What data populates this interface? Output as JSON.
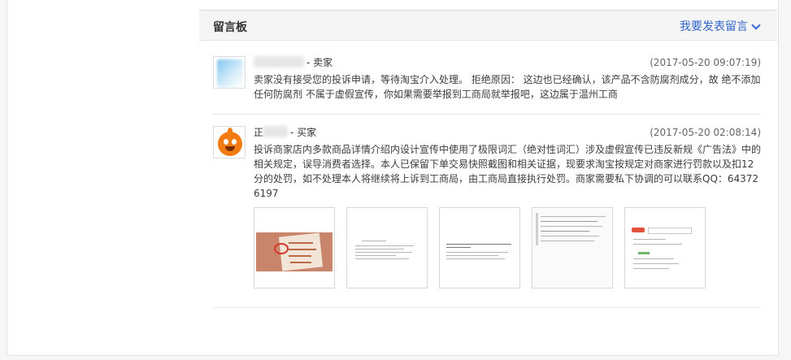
{
  "board": {
    "title": "留言板",
    "post_link": "我要发表留言"
  },
  "messages": [
    {
      "name_prefix": "",
      "role": "- 卖家",
      "timestamp": "(2017-05-20 09:07:19)",
      "content": "卖家没有接受您的投诉申请，等待淘宝介入处理。 拒绝原因： 这边也已经确认，该产品不含防腐剂成分，故 绝不添加任何防腐剂 不属于虚假宣传，你如果需要举报到工商局就举报吧，这边属于温州工商"
    },
    {
      "name_prefix": "正",
      "role": "- 买家",
      "timestamp": "(2017-05-20 02:08:14)",
      "content": "投诉商家店内多款商品详情介绍内设计宣传中使用了极限词汇（绝对性词汇）涉及虚假宣传已违反新规《广告法》中的相关规定，误导消费者选择。本人已保留下单交易快照截图和相关证据，现要求淘宝按规定对商家进行罚款以及扣12分的处罚，如不处理本人将继续将上诉到工商局，由工商局直接执行处罚。商家需要私下协调的可以联系QQ：643726197"
    }
  ],
  "icons": {
    "post_link": "chevron-down-icon",
    "seller_avatar": "avatar-placeholder",
    "buyer_avatar": "orange-mascot-icon"
  },
  "colors": {
    "link": "#3366cc",
    "mascot": "#f47a12"
  }
}
